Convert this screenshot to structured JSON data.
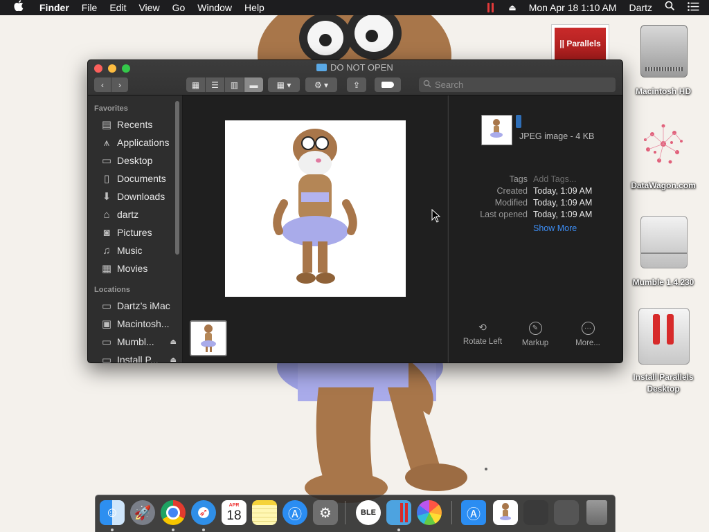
{
  "menubar": {
    "apple_icon": "apple-logo",
    "app_name": "Finder",
    "menus": [
      "File",
      "Edit",
      "View",
      "Go",
      "Window",
      "Help"
    ],
    "clock": "Mon Apr 18  1:10 AM",
    "user": "Dartz"
  },
  "desktop": {
    "parallels_ad_text": "|| Parallels",
    "icons": [
      {
        "label": "Macintosh HD"
      },
      {
        "label": "DataWagon.com"
      },
      {
        "label": "Mumble 1.4.230"
      },
      {
        "label": "Install Parallels Desktop"
      }
    ]
  },
  "window": {
    "title": "DO NOT OPEN",
    "search_placeholder": "Search",
    "sidebar": {
      "favorites_header": "Favorites",
      "favorites": [
        {
          "label": "Recents",
          "icon": "recents-icon"
        },
        {
          "label": "Applications",
          "icon": "applications-icon"
        },
        {
          "label": "Desktop",
          "icon": "desktop-icon"
        },
        {
          "label": "Documents",
          "icon": "documents-icon"
        },
        {
          "label": "Downloads",
          "icon": "downloads-icon"
        },
        {
          "label": "dartz",
          "icon": "home-icon"
        },
        {
          "label": "Pictures",
          "icon": "pictures-icon"
        },
        {
          "label": "Music",
          "icon": "music-icon"
        },
        {
          "label": "Movies",
          "icon": "movies-icon"
        }
      ],
      "locations_header": "Locations",
      "locations": [
        {
          "label": "Dartz’s iMac",
          "icon": "imac-icon"
        },
        {
          "label": "Macintosh...",
          "icon": "disk-icon"
        },
        {
          "label": "Mumbl...",
          "icon": "volume-icon"
        },
        {
          "label": "Install P...",
          "icon": "volume-icon"
        }
      ]
    },
    "info": {
      "kind": "JPEG image - 4 KB",
      "tags_label": "Tags",
      "tags_placeholder": "Add Tags...",
      "created_label": "Created",
      "created_value": "Today, 1:09 AM",
      "modified_label": "Modified",
      "modified_value": "Today, 1:09 AM",
      "last_opened_label": "Last opened",
      "last_opened_value": "Today, 1:09 AM",
      "show_more": "Show More"
    },
    "actions": [
      "Rotate Left",
      "Markup",
      "More..."
    ]
  },
  "dock": {
    "calendar_month": "APR",
    "calendar_day": "18"
  },
  "colors": {
    "menubar": "#1d1d1f",
    "window_bg": "#262626",
    "link": "#3d8ef5",
    "parallels_red": "#d72a2a"
  }
}
